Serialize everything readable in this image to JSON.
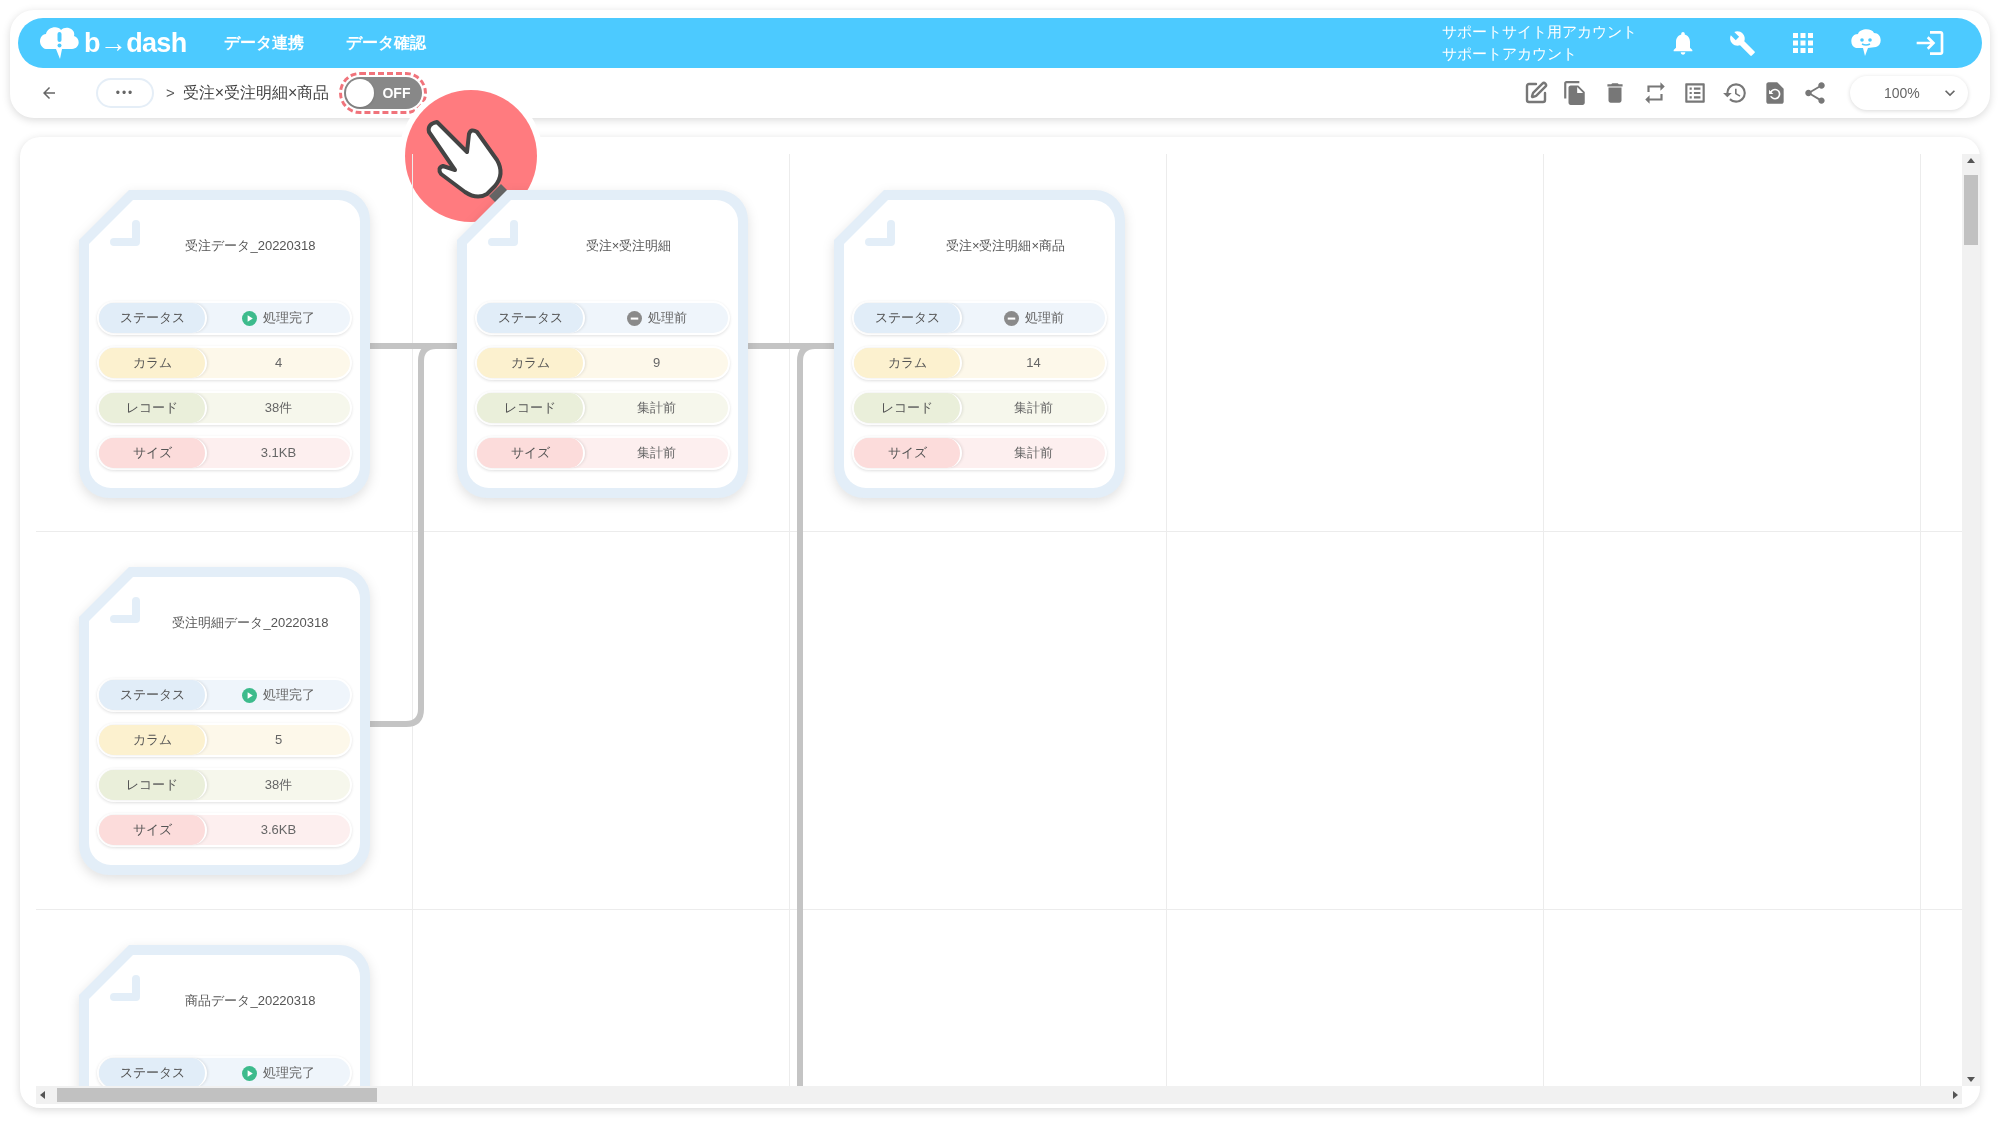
{
  "header": {
    "logo": "b→dash",
    "nav": [
      "データ連携",
      "データ確認"
    ],
    "account": [
      "サポートサイト用アカウント",
      "サポートアカウント"
    ]
  },
  "toolbar": {
    "more": "•••",
    "separator": ">",
    "breadcrumb": "受注×受注明細×商品",
    "toggle": {
      "label": "OFF",
      "on": false
    },
    "zoom": "100%"
  },
  "nodes": [
    {
      "title": "受注データ_20220318",
      "rows": [
        {
          "kind": "status",
          "label": "ステータス",
          "value": "処理完了",
          "completed": true
        },
        {
          "kind": "columns",
          "label": "カラム",
          "value": "4"
        },
        {
          "kind": "records",
          "label": "レコード",
          "value": "38件"
        },
        {
          "kind": "size",
          "label": "サイズ",
          "value": "3.1KB"
        }
      ]
    },
    {
      "title": "受注×受注明細",
      "rows": [
        {
          "kind": "status",
          "label": "ステータス",
          "value": "処理前",
          "completed": false
        },
        {
          "kind": "columns",
          "label": "カラム",
          "value": "9"
        },
        {
          "kind": "records",
          "label": "レコード",
          "value": "集計前"
        },
        {
          "kind": "size",
          "label": "サイズ",
          "value": "集計前"
        }
      ]
    },
    {
      "title": "受注×受注明細×商品",
      "rows": [
        {
          "kind": "status",
          "label": "ステータス",
          "value": "処理前",
          "completed": false
        },
        {
          "kind": "columns",
          "label": "カラム",
          "value": "14"
        },
        {
          "kind": "records",
          "label": "レコード",
          "value": "集計前"
        },
        {
          "kind": "size",
          "label": "サイズ",
          "value": "集計前"
        }
      ]
    },
    {
      "title": "受注明細データ_20220318",
      "rows": [
        {
          "kind": "status",
          "label": "ステータス",
          "value": "処理完了",
          "completed": true
        },
        {
          "kind": "columns",
          "label": "カラム",
          "value": "5"
        },
        {
          "kind": "records",
          "label": "レコード",
          "value": "38件"
        },
        {
          "kind": "size",
          "label": "サイズ",
          "value": "3.6KB"
        }
      ]
    },
    {
      "title": "商品データ_20220318",
      "rows": [
        {
          "kind": "status",
          "label": "ステータス",
          "value": "処理完了",
          "completed": true
        }
      ]
    }
  ]
}
